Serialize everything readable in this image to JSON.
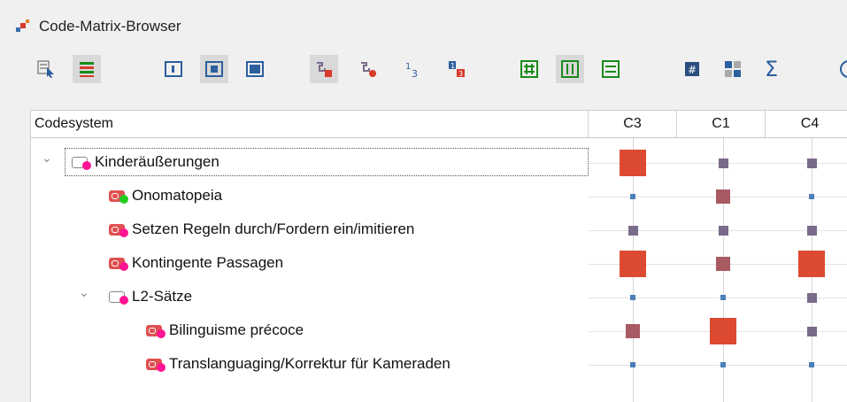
{
  "window": {
    "title": "Code-Matrix-Browser"
  },
  "toolbar": {
    "hash_label": "#",
    "sigma_label": "Σ"
  },
  "table": {
    "header": "Codesystem",
    "columns": [
      "C3",
      "C1",
      "C4"
    ]
  },
  "rows": [
    {
      "label": "Kinderäußerungen",
      "level": 0,
      "expanded": true,
      "tag": "#ffffff",
      "tag_border": "#888888",
      "dot": "#ff1493",
      "cells": [
        3,
        1,
        1
      ]
    },
    {
      "label": "Onomatopeia",
      "level": 1,
      "tag": "#e05050",
      "dot": "#22cc22",
      "cells": [
        0,
        2,
        0
      ]
    },
    {
      "label": "Setzen Regeln durch/Fordern ein/imitieren",
      "level": 1,
      "tag": "#e05050",
      "dot": "#ff1493",
      "cells": [
        1,
        1,
        1
      ]
    },
    {
      "label": "Kontingente Passagen",
      "level": 1,
      "tag": "#e05050",
      "dot": "#ff1493",
      "cells": [
        3,
        2,
        3
      ]
    },
    {
      "label": "L2-Sätze",
      "level": 1,
      "expanded": true,
      "tag": "#ffffff",
      "tag_border": "#888888",
      "dot": "#ff1493",
      "cells": [
        0,
        0,
        1
      ]
    },
    {
      "label": "Bilinguisme précoce",
      "level": 2,
      "tag": "#e05050",
      "dot": "#ff1493",
      "cells": [
        2,
        3,
        1
      ]
    },
    {
      "label": "Translanguaging/Korrektur für Kameraden",
      "level": 2,
      "tag": "#e05050",
      "dot": "#ff1493",
      "cells": [
        0,
        0,
        0
      ]
    }
  ],
  "colors": {
    "big": "#dd4a32",
    "mid": "#a85a63",
    "small": "#7a6a8a",
    "tiny": "#4a7fb8"
  }
}
